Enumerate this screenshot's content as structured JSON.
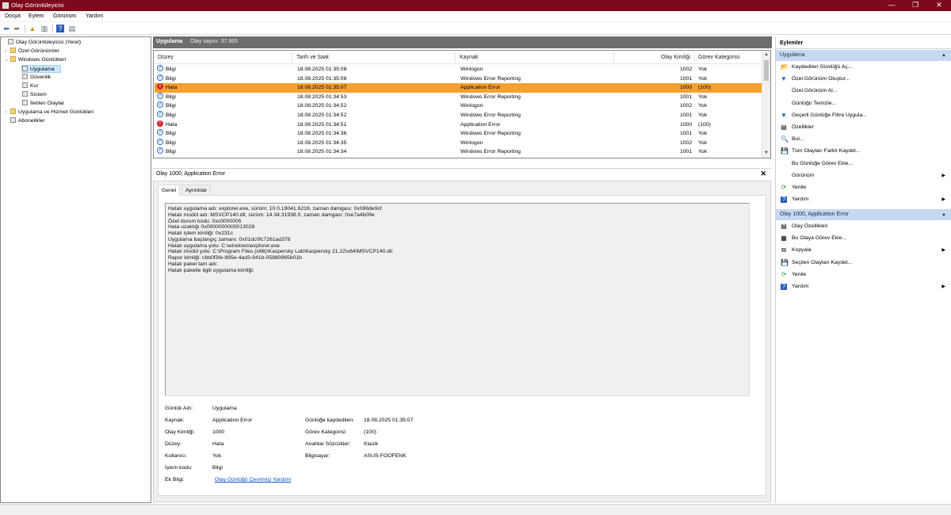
{
  "window": {
    "title": "Olay Görüntüleyicisi",
    "minimize": "—",
    "maximize": "❐",
    "close": "✕"
  },
  "menu": [
    "Dosya",
    "Eylem",
    "Görünüm",
    "Yardım"
  ],
  "tree": [
    {
      "label": "Olay Görüntüleyicisi (Yerel)",
      "expander": "",
      "selected": false
    },
    {
      "label": "Özel Görünümler",
      "expander": "›",
      "selected": false
    },
    {
      "label": "Windows Günlükleri",
      "expander": "⌄",
      "selected": false
    },
    {
      "label": "Uygulama",
      "expander": "",
      "selected": true
    },
    {
      "label": "Güvenlik",
      "expander": "",
      "selected": false
    },
    {
      "label": "Kur",
      "expander": "",
      "selected": false
    },
    {
      "label": "Sistem",
      "expander": "",
      "selected": false
    },
    {
      "label": "İletilen Olaylar",
      "expander": "",
      "selected": false
    },
    {
      "label": "Uygulama ve Hizmet Günlükleri",
      "expander": "›",
      "selected": false
    },
    {
      "label": "Abonelikler",
      "expander": "",
      "selected": false
    }
  ],
  "center": {
    "title": "Uygulama",
    "count": "Olay sayısı: 37.993"
  },
  "grid": {
    "columns": [
      "Düzey",
      "Tarih ve Saat",
      "Kaynak",
      "Olay Kimliği",
      "Görev Kategorisi"
    ],
    "rows": [
      {
        "level": "Bilgi",
        "icon": "i",
        "type": "info",
        "date": "18.08.2025 01:35:08",
        "source": "Winlogon",
        "id": "1002",
        "cat": "Yok",
        "selected": false
      },
      {
        "level": "Bilgi",
        "icon": "i",
        "type": "info",
        "date": "18.08.2025 01:35:08",
        "source": "Windows Error Reporting",
        "id": "1001",
        "cat": "Yok",
        "selected": false
      },
      {
        "level": "Hata",
        "icon": "!",
        "type": "error",
        "date": "18.08.2025 01:35:07",
        "source": "Application Error",
        "id": "1000",
        "cat": "(100)",
        "selected": true
      },
      {
        "level": "Bilgi",
        "icon": "i",
        "type": "info",
        "date": "18.08.2025 01:34:53",
        "source": "Windows Error Reporting",
        "id": "1001",
        "cat": "Yok",
        "selected": false
      },
      {
        "level": "Bilgi",
        "icon": "i",
        "type": "info",
        "date": "18.08.2025 01:34:52",
        "source": "Winlogon",
        "id": "1002",
        "cat": "Yok",
        "selected": false
      },
      {
        "level": "Bilgi",
        "icon": "i",
        "type": "info",
        "date": "18.08.2025 01:34:52",
        "source": "Windows Error Reporting",
        "id": "1001",
        "cat": "Yok",
        "selected": false
      },
      {
        "level": "Hata",
        "icon": "!",
        "type": "error",
        "date": "18.08.2025 01:34:51",
        "source": "Application Error",
        "id": "1000",
        "cat": "(100)",
        "selected": false
      },
      {
        "level": "Bilgi",
        "icon": "i",
        "type": "info",
        "date": "18.08.2025 01:34:36",
        "source": "Windows Error Reporting",
        "id": "1001",
        "cat": "Yok",
        "selected": false
      },
      {
        "level": "Bilgi",
        "icon": "i",
        "type": "info",
        "date": "18.08.2025 01:34:35",
        "source": "Winlogon",
        "id": "1002",
        "cat": "Yok",
        "selected": false
      },
      {
        "level": "Bilgi",
        "icon": "i",
        "type": "info",
        "date": "18.08.2025 01:34:34",
        "source": "Windows Error Reporting",
        "id": "1001",
        "cat": "Yok",
        "selected": false
      }
    ]
  },
  "detail": {
    "title": "Olay 1000, Application Error",
    "close": "✕",
    "tabs": [
      "Genel",
      "Ayrıntılar"
    ],
    "message": [
      "Hatalı uygulama adı: explorer.exe, sürüm: 10.0.19041.6216, zaman damgası: 0x086de9cf",
      "Hatalı modül adı: MSVCP140.dll, sürüm: 14.34.31938.0, zaman damgası: 0xe7a4b09e",
      "Özel durum kodu: 0xc0000005",
      "Hata uzaklığı 0x0000000000013028",
      "Hatalı işlem kimliği: 0x231c",
      "Uygulama başlangıç zamanı: 0x01dc0fc7261ad378",
      "Hatalı uygulama yolu: C:\\windows\\explorer.exe",
      "Hatalı modül yolu: C:\\Program Files (x86)\\Kaspersky Lab\\Kaspersky 21.22\\x64\\MSVCP140.dll",
      "Rapor kimliği: cbb0f3fe-895e-4ad3-941b-05880965b01b",
      "Hatalı paket tam adı:",
      "Hatalı paketle ilgili uygulama kimliği:"
    ],
    "props": {
      "log_label": "Günlük Adı:",
      "log_value": "Uygulama",
      "source_label": "Kaynak:",
      "source_value": "Application Error",
      "logged_label": "Günlüğe kaydedilen:",
      "logged_value": "18.08.2025 01:35:07",
      "eventid_label": "Olay Kimliği:",
      "eventid_value": "1000",
      "taskcat_label": "Görev Kategorisi:",
      "taskcat_value": "(100)",
      "level_label": "Düzey:",
      "level_value": "Hata",
      "keywords_label": "Anahtar Sözcükler:",
      "keywords_value": "Klasik",
      "user_label": "Kullanıcı:",
      "user_value": "Yok",
      "computer_label": "Bilgisayar:",
      "computer_value": "ASUS-FOOFENK",
      "opcode_label": "İşlem kodu:",
      "opcode_value": "Bilgi",
      "moreinfo_label": "Ek Bilgi:",
      "moreinfo_link": "Olay Günlüğü Çevrimiçi Yardımı"
    }
  },
  "actions": {
    "header": "Eylemler",
    "section1": "Uygulama",
    "items1": [
      {
        "label": "Kaydedilen Günlüğü Aç...",
        "icon": "📂",
        "arrow": ""
      },
      {
        "label": "Özel Görünüm Oluştur...",
        "icon": "▼",
        "arrow": ""
      },
      {
        "label": "Özel Görünüm Al...",
        "icon": "",
        "arrow": ""
      },
      {
        "label": "Günlüğü Temizle...",
        "icon": "",
        "arrow": ""
      },
      {
        "label": "Geçerli Günlüğe Filtre Uygula...",
        "icon": "▼",
        "arrow": ""
      },
      {
        "label": "Özellikler",
        "icon": "▤",
        "arrow": ""
      },
      {
        "label": "Bul...",
        "icon": "🔍",
        "arrow": ""
      },
      {
        "label": "Tüm Olayları Farklı Kaydet...",
        "icon": "💾",
        "arrow": ""
      },
      {
        "label": "Bu Günlüğe Görev Ekle...",
        "icon": "",
        "arrow": ""
      },
      {
        "label": "Görünüm",
        "icon": "",
        "arrow": "▶"
      },
      {
        "label": "Yenile",
        "icon": "⟳",
        "arrow": ""
      },
      {
        "label": "Yardım",
        "icon": "?",
        "arrow": "▶"
      }
    ],
    "section2": "Olay 1000, Application Error",
    "items2": [
      {
        "label": "Olay Özellikleri",
        "icon": "▤",
        "arrow": ""
      },
      {
        "label": "Bu Olaya Görev Ekle...",
        "icon": "▦",
        "arrow": ""
      },
      {
        "label": "Kopyala",
        "icon": "⧉",
        "arrow": "▶"
      },
      {
        "label": "Seçilen Olayları Kaydet...",
        "icon": "💾",
        "arrow": ""
      },
      {
        "label": "Yenile",
        "icon": "⟳",
        "arrow": ""
      },
      {
        "label": "Yardım",
        "icon": "?",
        "arrow": "▶"
      }
    ]
  },
  "colors": {
    "titlebar": "#7d0a1c",
    "selection": "#f5a030",
    "header": "#6d6d6d",
    "action_section": "#c7d9f0",
    "link": "#0a50c4"
  }
}
